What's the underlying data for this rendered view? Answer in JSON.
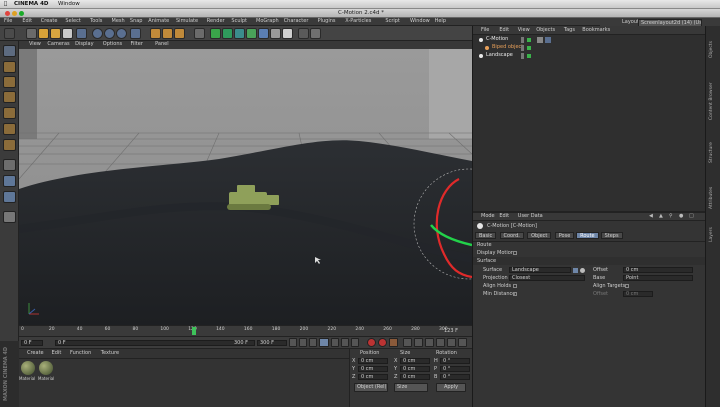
{
  "mac_menu": {
    "app": "CINEMA 4D",
    "window": "Window"
  },
  "window": {
    "title": "C-Motion 2.c4d *"
  },
  "menu": [
    "File",
    "Edit",
    "Create",
    "Select",
    "Tools",
    "Mesh",
    "Snap",
    "Animate",
    "Simulate",
    "Render",
    "Sculpt",
    "MoGraph",
    "Character",
    "Plugins",
    "X-Particles",
    "Script",
    "Window",
    "Help"
  ],
  "layout": {
    "label": "Layout:",
    "value": "Screenlayout2d (14) (User)"
  },
  "viewport_menu": [
    "View",
    "Cameras",
    "Display",
    "Options",
    "Filter",
    "Panel"
  ],
  "timeline": {
    "ticks": [
      "0",
      "20",
      "40",
      "60",
      "80",
      "100",
      "120",
      "140",
      "160",
      "180",
      "200",
      "220",
      "240",
      "260",
      "280",
      "300"
    ],
    "current_frame": "123 F"
  },
  "transport": {
    "start": "0 F",
    "start2": "0 F",
    "end": "300 F",
    "end2": "300 F"
  },
  "material_manager": {
    "menu": [
      "Create",
      "Edit",
      "Function",
      "Texture"
    ],
    "materials": [
      "Material",
      "Material"
    ],
    "brand": "MAXON CINEMA 4D"
  },
  "coordinates": {
    "headers": [
      "Position",
      "Size",
      "Rotation"
    ],
    "rows": [
      {
        "pos_axis": "X",
        "pos": "0 cm",
        "size_axis": "X",
        "size": "0 cm",
        "rot_axis": "H",
        "rot": "0 °"
      },
      {
        "pos_axis": "Y",
        "pos": "0 cm",
        "size_axis": "Y",
        "size": "0 cm",
        "rot_axis": "P",
        "rot": "0 °"
      },
      {
        "pos_axis": "Z",
        "pos": "0 cm",
        "size_axis": "Z",
        "size": "0 cm",
        "rot_axis": "B",
        "rot": "0 °"
      }
    ],
    "mode": "Object (Rel)",
    "size_mode": "Size",
    "apply": "Apply"
  },
  "object_manager": {
    "menu": [
      "File",
      "Edit",
      "View",
      "Objects",
      "Tags",
      "Bookmarks"
    ],
    "objects": [
      {
        "name": "C-Motion",
        "indent": 0,
        "color": "#e9e9e9"
      },
      {
        "name": "Biped object",
        "indent": 1,
        "color": "#e8a05a"
      },
      {
        "name": "Landscape",
        "indent": 0,
        "color": "#e9e9e9"
      }
    ]
  },
  "attributes": {
    "menu": [
      "Mode",
      "Edit",
      "User Data"
    ],
    "object_title": "C-Motion [C-Motion]",
    "tabs": [
      "Basic",
      "Coord.",
      "Object",
      "Pose",
      "Route",
      "Steps"
    ],
    "active_tab": "Route",
    "section": "Route",
    "display_motion": "Display Motion",
    "group": "Surface",
    "surface_label": "Surface",
    "surface_value": "Landscape",
    "offset_label": "Offset",
    "offset_value": "0 cm",
    "projection_label": "Projection",
    "projection_value": "Closest",
    "base_label": "Base",
    "base_value": "Point",
    "align_holds": "Align Holds",
    "align_targets": "Align Targets",
    "min_distance": "Min Distance",
    "offset2_label": "Offset",
    "offset2_value": "0 cm"
  },
  "side_tabs": [
    "Objects",
    "Content Browser",
    "Structure",
    "Attributes",
    "Layers"
  ],
  "colors": {
    "accent": "#6e86a8",
    "tank": "#8fa05a",
    "path_green": "#22d24a",
    "path_red": "#e02a2a"
  }
}
